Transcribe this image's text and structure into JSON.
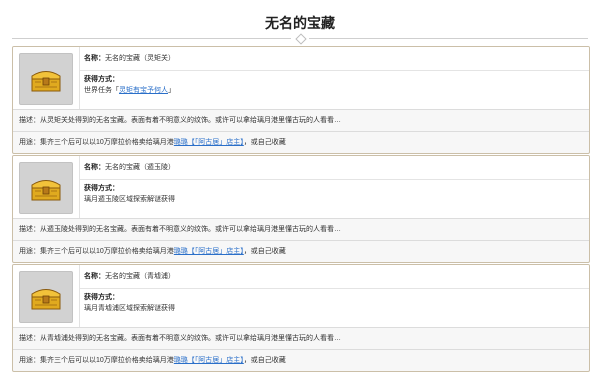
{
  "page": {
    "title": "无名的宝藏"
  },
  "cards": [
    {
      "name_label": "名称：",
      "name_value": "无名的宝藏（灵矩关）",
      "obtain_label": "获得方式：",
      "obtain_prefix": "世界任务「",
      "obtain_link": "灵矩有宝予何人",
      "obtain_suffix": "」",
      "obtain_text": "",
      "desc_label": "描述：",
      "desc_text": "从灵矩关处得到的无名宝藏。表面有着不明意义的纹饰。或许可以拿给璃月港里懂古玩的人看看…",
      "use_label": "用途：",
      "use_prefix": "集齐三个后可以以10万摩拉价格卖给璃月港",
      "use_link": "璐璐【「阿古居」店主】",
      "use_suffix": "，或自己收藏"
    },
    {
      "name_label": "名称：",
      "name_value": "无名的宝藏（遁玉陵）",
      "obtain_label": "获得方式：",
      "obtain_prefix": "",
      "obtain_link": "",
      "obtain_suffix": "",
      "obtain_text": "璃月遁玉陵区域探索解谜获得",
      "desc_label": "描述：",
      "desc_text": "从遁玉陵处得到的无名宝藏。表面有着不明意义的纹饰。或许可以拿给璃月港里懂古玩的人看看…",
      "use_label": "用途：",
      "use_prefix": "集齐三个后可以以10万摩拉价格卖给璃月港",
      "use_link": "璐璐【「阿古居」店主】",
      "use_suffix": "，或自己收藏"
    },
    {
      "name_label": "名称：",
      "name_value": "无名的宝藏（青墟浦）",
      "obtain_label": "获得方式：",
      "obtain_prefix": "",
      "obtain_link": "",
      "obtain_suffix": "",
      "obtain_text": "璃月青墟浦区域探索解谜获得",
      "desc_label": "描述：",
      "desc_text": "从青墟浦处得到的无名宝藏。表面有着不明意义的纹饰。或许可以拿给璃月港里懂古玩的人看看…",
      "use_label": "用途：",
      "use_prefix": "集齐三个后可以以10万摩拉价格卖给璃月港",
      "use_link": "璐璐【「阿古居」店主】",
      "use_suffix": "，或自己收藏"
    }
  ],
  "colors": {
    "link": "#2a6fc9",
    "border": "#cbbfa8",
    "chest_gold": "#e0aa1f"
  },
  "icons": {
    "item": "treasure-chest-icon"
  }
}
